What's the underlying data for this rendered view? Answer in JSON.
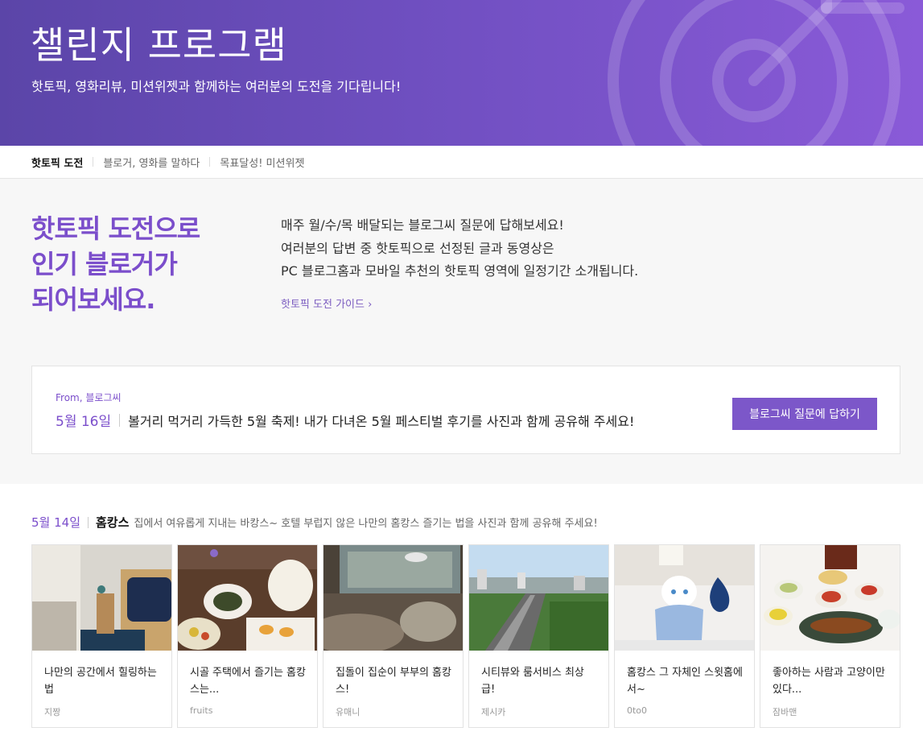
{
  "hero": {
    "title": "챌린지 프로그램",
    "subtitle": "핫토픽, 영화리뷰, 미션위젯과 함께하는 여러분의 도전을 기다립니다!"
  },
  "tabs": [
    {
      "label": "핫토픽 도전",
      "active": true
    },
    {
      "label": "블로거, 영화를 말하다",
      "active": false
    },
    {
      "label": "목표달성! 미션위젯",
      "active": false
    }
  ],
  "intro": {
    "heading": [
      "핫토픽 도전으로",
      "인기 블로거가",
      "되어보세요."
    ],
    "lines": [
      "매주 월/수/목 배달되는 블로그씨 질문에 답해보세요!",
      "여러분의 답변 중 핫토픽으로 선정된 글과 동영상은",
      "PC 블로그홈과 모바일 추천의 핫토픽 영역에 일정기간 소개됩니다."
    ],
    "guide_link": "핫토픽 도전 가이드 ›"
  },
  "question": {
    "from": "From, 블로그씨",
    "date": "5월 16일",
    "text": "볼거리 먹거리 가득한 5월 축제! 내가 다녀온 5월 페스티벌 후기를 사진과 함께 공유해 주세요!",
    "button": "블로그씨 질문에 답하기"
  },
  "topic": {
    "date": "5월 14일",
    "title": "홈캉스",
    "desc": "집에서 여유롭게 지내는 바캉스~ 호텔 부럽지 않은 나만의 홈캉스 즐기는 법을 사진과 함께 공유해 주세요!"
  },
  "cards": [
    {
      "title": "나만의 공간에서 힐링하는 법",
      "author": "지짱"
    },
    {
      "title": "시골 주택에서 즐기는 홈캉스는...",
      "author": "fruits"
    },
    {
      "title": "집돌이 집순이 부부의 홈캉스!",
      "author": "유매니"
    },
    {
      "title": "시티뷰와 룸서비스 최상급!",
      "author": "제시카"
    },
    {
      "title": "홈캉스 그 자체인 스윗홈에서~",
      "author": "0to0"
    },
    {
      "title": "좋아하는 사람과 고양이만 있다...",
      "author": "잠바맨"
    }
  ],
  "colors": {
    "accent": "#7b4ecb",
    "button": "#7c57c9",
    "hero_start": "#5b45a8",
    "hero_end": "#8a5ad8"
  },
  "icons": {
    "hero": "target-arrow-icon"
  }
}
